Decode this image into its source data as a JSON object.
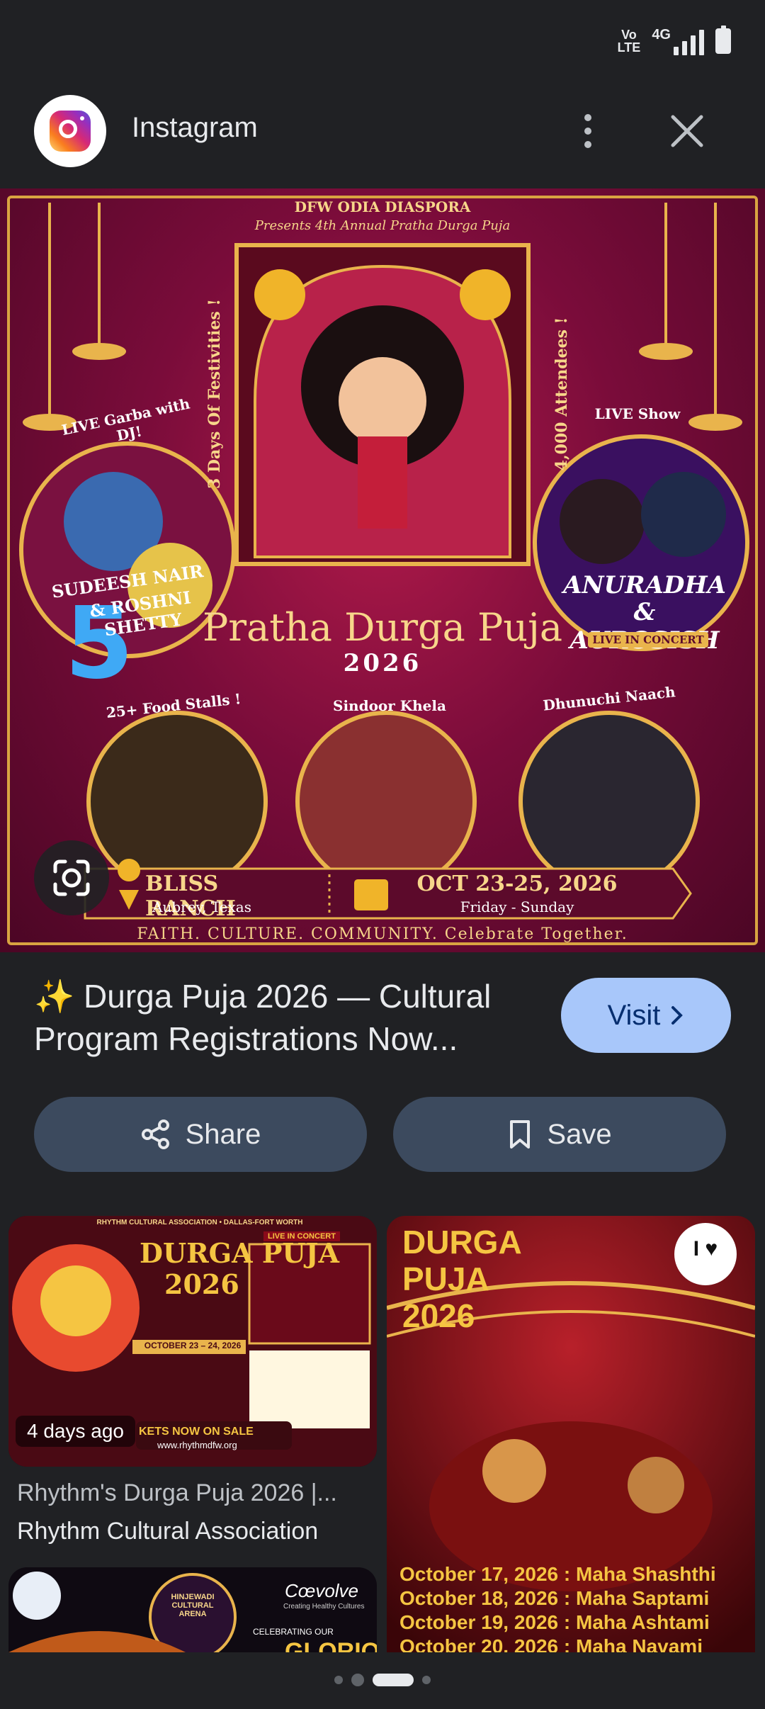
{
  "status_bar": {
    "volte": "Vo\nLTE",
    "network": "4G"
  },
  "header": {
    "app_name": "Instagram",
    "more_icon": "more-vert-icon",
    "close_icon": "close-icon"
  },
  "hero": {
    "top_line_1": "DFW ODIA DIASPORA",
    "top_line_2": "Presents 4th Annual Pratha Durga Puja",
    "left_arc": "LIVE Garba with DJ!",
    "left_names_1": "SUDEESH NAIR",
    "left_names_2": "& ROSHNI SHETTY",
    "side_left": "3 Days Of Festivities !",
    "side_right": "4,000 Attendees !",
    "right_arc": "LIVE Show",
    "right_names_1": "ANURADHA",
    "right_names_2": "& AUROSISH",
    "right_tag": "LIVE IN CONCERT",
    "event_name": "Pratha Durga Puja",
    "event_year": "2026",
    "circle_1": "25+ Food Stalls !",
    "circle_2": "Sindoor Khela",
    "circle_3": "Dhunuchi Naach",
    "venue": "BLISS RANCH",
    "venue_city": "Aubrey, Texas",
    "dates": "OCT 23-25, 2026",
    "days": "Friday - Sunday",
    "tagline": "FAITH. CULTURE. COMMUNITY. Celebrate Together.",
    "lens_icon": "google-lens-icon"
  },
  "result": {
    "title": "✨ Durga Puja 2026 — Cultural Program Registrations Now...",
    "visit_label": "Visit",
    "share_label": "Share",
    "save_label": "Save"
  },
  "cards": [
    {
      "header": "RHYTHM CULTURAL ASSOCIATION • DALLAS-FORT WORTH",
      "heading_1": "DURGA PUJA",
      "heading_2": "2026",
      "date_band": "OCTOBER 23 – 24, 2026",
      "live_tag": "LIVE IN CONCERT",
      "ticket_banner": "KETS NOW ON SALE",
      "website": "www.rhythmdfw.org",
      "time_ago": "4 days ago",
      "caption": "Rhythm's Durga Puja 2026 |...",
      "source": "Rhythm Cultural Association"
    },
    {
      "heading_1": "DURGA",
      "heading_2": "PUJA",
      "heading_3": "2026",
      "badge": "I ♥",
      "dates": [
        "October 17, 2026 : Maha Shashthi",
        "October 18, 2026 : Maha Saptami",
        "October 19, 2026 : Maha Ashtami",
        "October 20, 2026 : Maha Navami"
      ]
    },
    {
      "logo_text": "Cœvolve",
      "logo_sub": "Creating Healthy Cultures",
      "arena": "HINJEWADI CULTURAL ARENA",
      "celebrating": "CELEBRATING OUR",
      "glorious": "GLORIOUS"
    }
  ],
  "colors": {
    "background": "#202124",
    "visit": "#a8c7fa",
    "action": "#3c4a5e",
    "gold": "#f7d68a"
  }
}
